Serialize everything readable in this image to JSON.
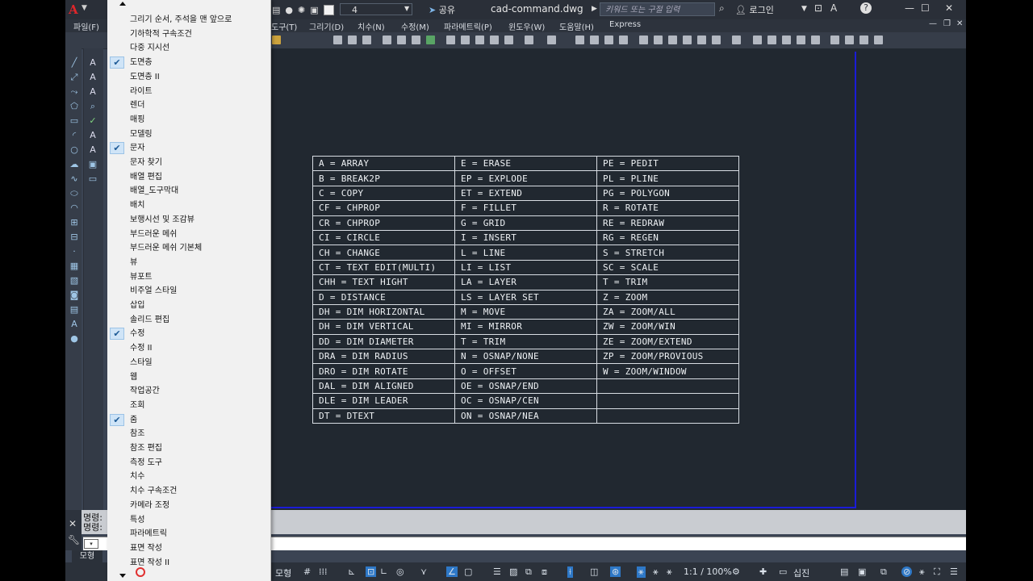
{
  "titlebar": {
    "logo": "A",
    "layer_value": "4",
    "share_label": "공유",
    "doc_title": "cad-command.dwg",
    "search_placeholder": "키워드 또는 구절 입력",
    "user_label": "로그인",
    "help_icon": "?"
  },
  "menubar": {
    "items": [
      "파일(F)",
      "도구(T)",
      "그리기(D)",
      "치수(N)",
      "수정(M)",
      "파라메트릭(P)",
      "윈도우(W)",
      "도움말(H)",
      "Express"
    ]
  },
  "dropdown": {
    "items": [
      {
        "label": "그리기 순서, 주석을 맨 앞으로",
        "checked": false
      },
      {
        "label": "기하학적 구속조건",
        "checked": false
      },
      {
        "label": "다중 지시선",
        "checked": false
      },
      {
        "label": "도면층",
        "checked": true
      },
      {
        "label": "도면층 II",
        "checked": false
      },
      {
        "label": "라이트",
        "checked": false
      },
      {
        "label": "렌더",
        "checked": false
      },
      {
        "label": "매핑",
        "checked": false
      },
      {
        "label": "모델링",
        "checked": false
      },
      {
        "label": "문자",
        "checked": true
      },
      {
        "label": "문자 찾기",
        "checked": false
      },
      {
        "label": "배열 편집",
        "checked": false
      },
      {
        "label": "배열_도구막대",
        "checked": false
      },
      {
        "label": "배치",
        "checked": false
      },
      {
        "label": "보행시선 및 조감뷰",
        "checked": false
      },
      {
        "label": "부드러운 메쉬",
        "checked": false
      },
      {
        "label": "부드러운 메쉬 기본체",
        "checked": false
      },
      {
        "label": "뷰",
        "checked": false
      },
      {
        "label": "뷰포트",
        "checked": false
      },
      {
        "label": "비주얼 스타일",
        "checked": false
      },
      {
        "label": "삽입",
        "checked": false
      },
      {
        "label": "솔리드 편집",
        "checked": false
      },
      {
        "label": "수정",
        "checked": true
      },
      {
        "label": "수정 II",
        "checked": false
      },
      {
        "label": "스타일",
        "checked": false
      },
      {
        "label": "웹",
        "checked": false
      },
      {
        "label": "작업공간",
        "checked": false
      },
      {
        "label": "조회",
        "checked": false
      },
      {
        "label": "줌",
        "checked": true
      },
      {
        "label": "참조",
        "checked": false
      },
      {
        "label": "참조 편집",
        "checked": false
      },
      {
        "label": "측정 도구",
        "checked": false
      },
      {
        "label": "치수",
        "checked": false
      },
      {
        "label": "치수 구속조건",
        "checked": false
      },
      {
        "label": "카메라 조정",
        "checked": false
      },
      {
        "label": "특성",
        "checked": false
      },
      {
        "label": "파라메트릭",
        "checked": false
      },
      {
        "label": "표면 작성",
        "checked": false
      },
      {
        "label": "표면 작성 II",
        "checked": false
      }
    ]
  },
  "command_table": {
    "rows": [
      [
        "A = ARRAY",
        "E = ERASE",
        "PE = PEDIT"
      ],
      [
        "B = BREAK2P",
        "EP = EXPLODE",
        "PL = PLINE"
      ],
      [
        "C = COPY",
        "ET = EXTEND",
        "PG = POLYGON"
      ],
      [
        "CF = CHPROP",
        "F = FILLET",
        "R = ROTATE"
      ],
      [
        "CR = CHPROP",
        "G = GRID",
        "RE = REDRAW"
      ],
      [
        "CI = CIRCLE",
        "I = INSERT",
        "RG = REGEN"
      ],
      [
        "CH = CHANGE",
        "L = LINE",
        "S = STRETCH"
      ],
      [
        "CT = TEXT EDIT(MULTI)",
        "LI = LIST",
        "SC = SCALE"
      ],
      [
        "CHH = TEXT HIGHT",
        "LA = LAYER",
        "T = TRIM"
      ],
      [
        "D = DISTANCE",
        "LS = LAYER SET",
        "Z = ZOOM"
      ],
      [
        "DH = DIM HORIZONTAL",
        "M = MOVE",
        "ZA = ZOOM/ALL"
      ],
      [
        "DH = DIM VERTICAL",
        "MI = MIRROR",
        "ZW = ZOOM/WIN"
      ],
      [
        "DD = DIM DIAMETER",
        "T = TRIM",
        "ZE = ZOOM/EXTEND"
      ],
      [
        "DRA = DIM RADIUS",
        "N = OSNAP/NONE",
        "ZP = ZOOM/PROVIOUS"
      ],
      [
        "DRO = DIM ROTATE",
        "O = OFFSET",
        "W = ZOOM/WINDOW"
      ],
      [
        "DAL = DIM ALIGNED",
        "OE = OSNAP/END",
        ""
      ],
      [
        "DLE = DIM LEADER",
        "OC = OSNAP/CEN",
        ""
      ],
      [
        "DT = DTEXT",
        "ON = OSNAP/NEA",
        ""
      ]
    ]
  },
  "command_area": {
    "line1": "명령:",
    "line2": "명령:"
  },
  "statusbar": {
    "model_tab": "모형",
    "model_label": "모형",
    "scale": "1:1 / 100%",
    "workspace_label": "십진"
  }
}
